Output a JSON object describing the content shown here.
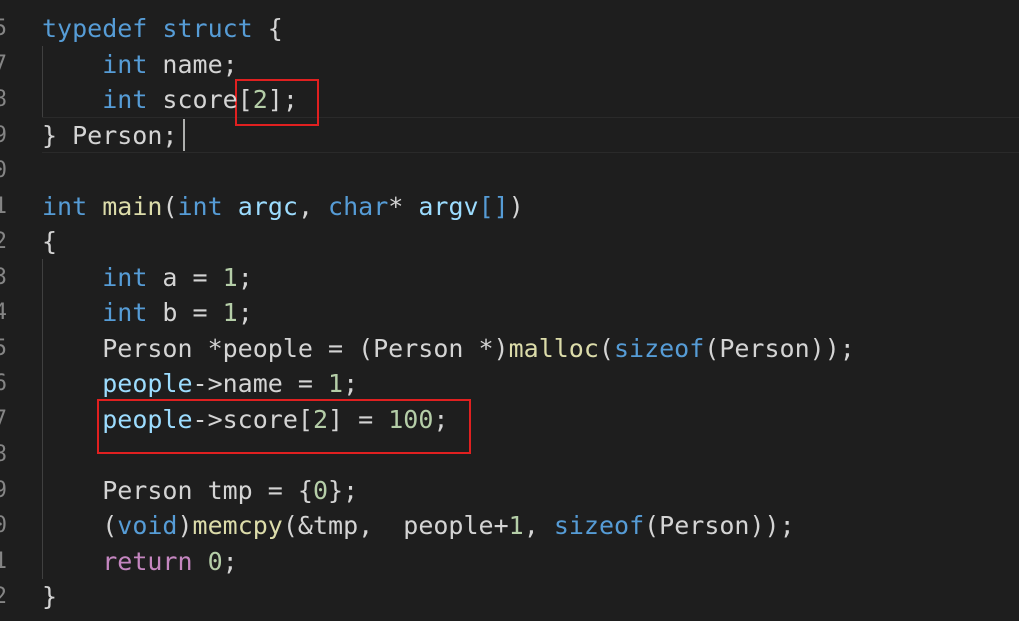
{
  "gutter": {
    "line_numbers": [
      "5",
      "7",
      "8",
      "9",
      "0",
      "1",
      "2",
      "3",
      "4",
      "5",
      "6",
      "7",
      "8",
      "9",
      "0",
      "1",
      "2"
    ]
  },
  "code": {
    "lines": [
      [
        {
          "t": "kw",
          "v": "typedef"
        },
        {
          "t": "punc",
          "v": " "
        },
        {
          "t": "kw",
          "v": "struct"
        },
        {
          "t": "punc",
          "v": " {"
        }
      ],
      [
        {
          "t": "punc",
          "v": "    "
        },
        {
          "t": "kw",
          "v": "int"
        },
        {
          "t": "punc",
          "v": " name;"
        }
      ],
      [
        {
          "t": "punc",
          "v": "    "
        },
        {
          "t": "kw",
          "v": "int"
        },
        {
          "t": "punc",
          "v": " score["
        },
        {
          "t": "num",
          "v": "2"
        },
        {
          "t": "punc",
          "v": "];"
        }
      ],
      [
        {
          "t": "punc",
          "v": "} Person;"
        }
      ],
      [],
      [
        {
          "t": "kw",
          "v": "int"
        },
        {
          "t": "punc",
          "v": " "
        },
        {
          "t": "fn",
          "v": "main"
        },
        {
          "t": "punc",
          "v": "("
        },
        {
          "t": "kw",
          "v": "int"
        },
        {
          "t": "punc",
          "v": " "
        },
        {
          "t": "var",
          "v": "argc"
        },
        {
          "t": "punc",
          "v": ", "
        },
        {
          "t": "kw",
          "v": "char"
        },
        {
          "t": "punc",
          "v": "* "
        },
        {
          "t": "var",
          "v": "argv"
        },
        {
          "t": "kw",
          "v": "[]"
        },
        {
          "t": "punc",
          "v": ")"
        }
      ],
      [
        {
          "t": "punc",
          "v": "{"
        }
      ],
      [
        {
          "t": "punc",
          "v": "    "
        },
        {
          "t": "kw",
          "v": "int"
        },
        {
          "t": "punc",
          "v": " a = "
        },
        {
          "t": "num",
          "v": "1"
        },
        {
          "t": "punc",
          "v": ";"
        }
      ],
      [
        {
          "t": "punc",
          "v": "    "
        },
        {
          "t": "kw",
          "v": "int"
        },
        {
          "t": "punc",
          "v": " b = "
        },
        {
          "t": "num",
          "v": "1"
        },
        {
          "t": "punc",
          "v": ";"
        }
      ],
      [
        {
          "t": "punc",
          "v": "    Person *people = (Person *)"
        },
        {
          "t": "fn",
          "v": "malloc"
        },
        {
          "t": "punc",
          "v": "("
        },
        {
          "t": "kw",
          "v": "sizeof"
        },
        {
          "t": "punc",
          "v": "(Person));"
        }
      ],
      [
        {
          "t": "punc",
          "v": "    "
        },
        {
          "t": "var",
          "v": "people"
        },
        {
          "t": "punc",
          "v": "->name = "
        },
        {
          "t": "num",
          "v": "1"
        },
        {
          "t": "punc",
          "v": ";"
        }
      ],
      [
        {
          "t": "punc",
          "v": "    "
        },
        {
          "t": "var",
          "v": "people"
        },
        {
          "t": "punc",
          "v": "->score["
        },
        {
          "t": "num",
          "v": "2"
        },
        {
          "t": "punc",
          "v": "] = "
        },
        {
          "t": "num",
          "v": "100"
        },
        {
          "t": "punc",
          "v": ";"
        }
      ],
      [],
      [
        {
          "t": "punc",
          "v": "    Person tmp = {"
        },
        {
          "t": "num",
          "v": "0"
        },
        {
          "t": "punc",
          "v": "};"
        }
      ],
      [
        {
          "t": "punc",
          "v": "    ("
        },
        {
          "t": "kw",
          "v": "void"
        },
        {
          "t": "punc",
          "v": ")"
        },
        {
          "t": "fn",
          "v": "memcpy"
        },
        {
          "t": "punc",
          "v": "(&tmp,  people+"
        },
        {
          "t": "num",
          "v": "1"
        },
        {
          "t": "punc",
          "v": ", "
        },
        {
          "t": "kw",
          "v": "sizeof"
        },
        {
          "t": "punc",
          "v": "(Person));"
        }
      ],
      [
        {
          "t": "punc",
          "v": "    "
        },
        {
          "t": "ctrl",
          "v": "return"
        },
        {
          "t": "punc",
          "v": " "
        },
        {
          "t": "num",
          "v": "0"
        },
        {
          "t": "punc",
          "v": ";"
        }
      ],
      [
        {
          "t": "punc",
          "v": "}"
        }
      ]
    ]
  },
  "colors": {
    "background": "#1e1e1e",
    "keyword": "#569cd6",
    "control": "#c586c0",
    "function": "#dcdcaa",
    "number": "#b5cea8",
    "variable": "#9cdcfe",
    "text": "#d4d4d4",
    "annotation_box": "#e02020"
  }
}
